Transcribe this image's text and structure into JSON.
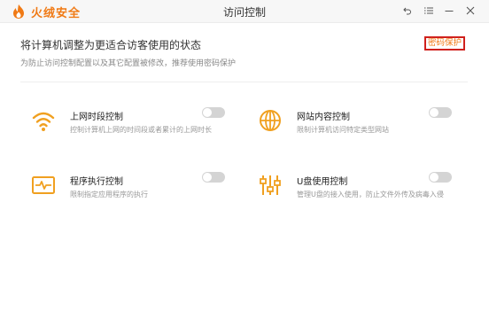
{
  "app": {
    "brand": "火绒安全",
    "window_title": "访问控制",
    "accent": "#f07a15"
  },
  "header": {
    "title": "将计算机调整为更适合访客使用的状态",
    "subtitle": "为防止访问控制配置以及其它配置被修改，推荐使用密码保护",
    "password_button": "密码保护"
  },
  "features": [
    {
      "title": "上网时段控制",
      "desc": "控制计算机上网的时间段或者累计的上网时长",
      "icon": "wifi-icon",
      "enabled": false
    },
    {
      "title": "网站内容控制",
      "desc": "限制计算机访问特定类型网站",
      "icon": "globe-icon",
      "enabled": false
    },
    {
      "title": "程序执行控制",
      "desc": "限制指定应用程序的执行",
      "icon": "program-monitor-icon",
      "enabled": false
    },
    {
      "title": "U盘使用控制",
      "desc": "管理U盘的接入使用，防止文件外传及病毒入侵",
      "icon": "sliders-icon",
      "enabled": false
    }
  ]
}
